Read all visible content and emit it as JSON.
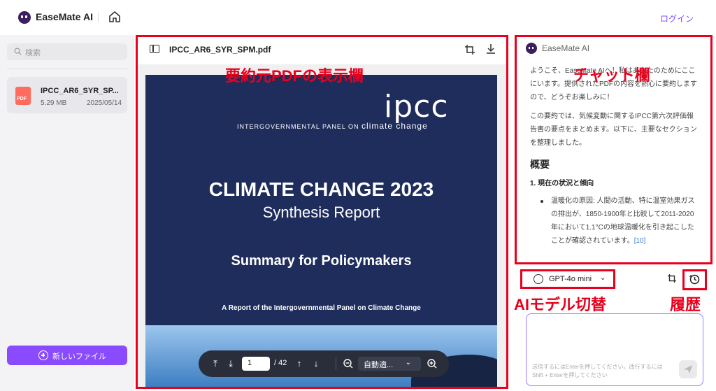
{
  "app": {
    "name": "EaseMate AI",
    "login_label": "ログイン"
  },
  "sidebar": {
    "search_placeholder": "検索",
    "files": [
      {
        "name": "IPCC_AR6_SYR_SP...",
        "size": "5.29 MB",
        "date": "2025/05/14",
        "icon_label": "PDF"
      }
    ],
    "new_file_label": "新しいファイル"
  },
  "viewer": {
    "file_title": "IPCC_AR6_SYR_SPM.pdf",
    "annotation": "要約元PDFの表示欄",
    "page": {
      "logo": "ipcc",
      "org_line": "INTERGOVERNMENTAL PANEL ON",
      "org_line_tail": "climate change",
      "title": "CLIMATE CHANGE 2023",
      "subtitle": "Synthesis Report",
      "summary": "Summary for Policymakers",
      "report_line": "A Report of the Intergovernmental Panel on Climate Change"
    },
    "pager": {
      "current_page": "1",
      "total_pages": "/ 42",
      "zoom_label": "自動適..."
    }
  },
  "chat": {
    "annotation": "チャット欄",
    "bot_name": "EaseMate AI",
    "intro": "ようこそ、EaseMate AIへ！私はあなたのためにここにいます。提供されたPDFの内容を熱心に要約しますので、どうぞお楽しみに！",
    "summary_intro": "この要約では、気候変動に関するIPCC第六次評価報告書の要点をまとめます。以下に、主要なセクションを整理しました。",
    "heading": "概要",
    "subheading": "1. 現在の状況と傾向",
    "bullet": "温暖化の原因: 人間の活動、特に温室効果ガスの排出が、1850-1900年と比較して2011-2020年において1.1°Cの地球温暖化を引き起こしたことが確認されています。",
    "bullet_ref": "[10]",
    "model_label": "GPT-4o mini",
    "model_annotation": "AIモデル切替",
    "history_annotation": "履歴",
    "input_placeholder": "送信するにはEnterを押してください。改行するにはShift + Enterを押してください"
  },
  "colors": {
    "accent": "#8a4bff",
    "annotation_red": "#e8001d",
    "pdf_navy": "#1f2d5c"
  }
}
